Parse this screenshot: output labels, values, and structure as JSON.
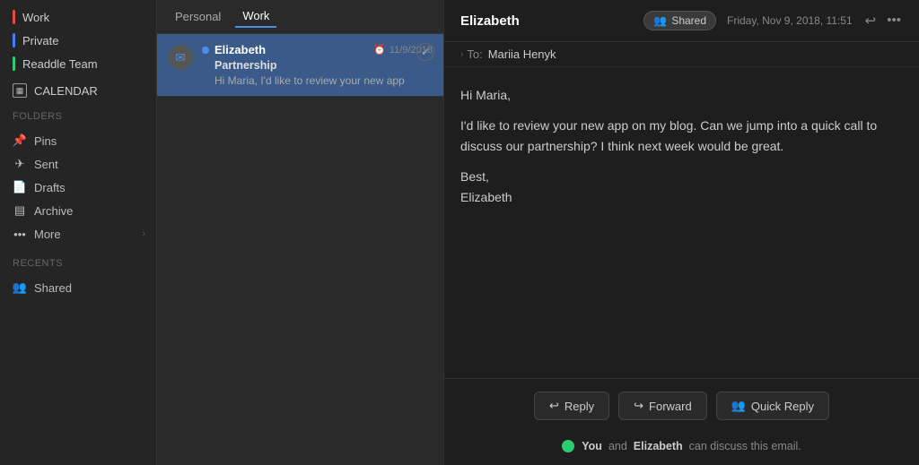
{
  "sidebar": {
    "inbox_items": [
      {
        "label": "Work",
        "indicator": "red",
        "id": "work"
      },
      {
        "label": "Private",
        "indicator": "blue",
        "id": "private"
      },
      {
        "label": "Readdle Team",
        "indicator": "green",
        "id": "readdle-team"
      }
    ],
    "calendar_label": "CALENDAR",
    "folders_title": "Folders",
    "folders": [
      {
        "label": "Pins",
        "icon": "📌",
        "id": "pins"
      },
      {
        "label": "Sent",
        "icon": "✈",
        "id": "sent"
      },
      {
        "label": "Drafts",
        "icon": "📄",
        "id": "drafts"
      },
      {
        "label": "Archive",
        "icon": "▤",
        "id": "archive"
      },
      {
        "label": "More",
        "icon": "•••",
        "id": "more"
      }
    ],
    "recents_title": "Recents",
    "recents": [
      {
        "label": "Shared",
        "icon": "👥",
        "id": "shared"
      }
    ]
  },
  "email_list": {
    "tabs": [
      {
        "label": "Personal",
        "id": "personal"
      },
      {
        "label": "Work",
        "id": "work"
      }
    ],
    "active_tab": "personal",
    "emails": [
      {
        "sender": "Elizabeth",
        "date": "11/9/2018",
        "subject": "Partnership",
        "preview": "Hi Maria, I'd like to review your new app",
        "unread": true,
        "selected": true
      }
    ]
  },
  "email_detail": {
    "sender": "Elizabeth",
    "shared_label": "Shared",
    "date": "Friday, Nov 9, 2018, 11:51",
    "to_label": "To:",
    "to_name": "Mariia Henyk",
    "body_greeting": "Hi Maria,",
    "body_paragraph": "I'd like to review your new app on my blog. Can we jump into a quick call to discuss our partnership? I think next week would be great.",
    "body_closing": "Best,",
    "body_name": "Elizabeth",
    "actions": [
      {
        "label": "Reply",
        "id": "reply"
      },
      {
        "label": "Forward",
        "id": "forward"
      },
      {
        "label": "Quick Reply",
        "id": "quick-reply"
      }
    ],
    "discuss_prefix": "You",
    "discuss_and": "and",
    "discuss_name": "Elizabeth",
    "discuss_suffix": "can discuss this email."
  }
}
